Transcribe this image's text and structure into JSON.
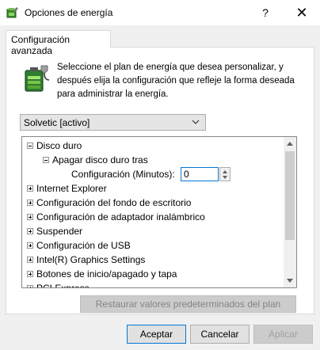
{
  "window": {
    "title": "Opciones de energía",
    "icon": "power-options-icon",
    "help_symbol": "?",
    "close_symbol": "✕"
  },
  "tab": {
    "label": "Configuración avanzada"
  },
  "description": "Seleccione el plan de energía que desea personalizar, y después elija la configuración que refleje la forma deseada para administrar la energía.",
  "plan_select": {
    "value": "Solvetic [activo]"
  },
  "tree": {
    "items": [
      {
        "label": "Disco duro",
        "expander": "minus"
      },
      {
        "label": "Apagar disco duro tras",
        "expander": "minus"
      },
      {
        "label": "Configuración (Minutos):",
        "value": "0"
      },
      {
        "label": "Internet Explorer",
        "expander": "plus"
      },
      {
        "label": "Configuración del fondo de escritorio",
        "expander": "plus"
      },
      {
        "label": "Configuración de adaptador inalámbrico",
        "expander": "plus"
      },
      {
        "label": "Suspender",
        "expander": "plus"
      },
      {
        "label": "Configuración de USB",
        "expander": "plus"
      },
      {
        "label": "Intel(R) Graphics Settings",
        "expander": "plus"
      },
      {
        "label": "Botones de inicio/apagado y tapa",
        "expander": "plus"
      },
      {
        "label": "PCI Express",
        "expander": "plus"
      }
    ]
  },
  "buttons": {
    "restore": "Restaurar valores predeterminados del plan",
    "ok": "Aceptar",
    "cancel": "Cancelar",
    "apply": "Aplicar"
  },
  "colors": {
    "accent": "#0078d7",
    "window_bg": "#f0f0f0",
    "disabled_text": "#838383"
  }
}
